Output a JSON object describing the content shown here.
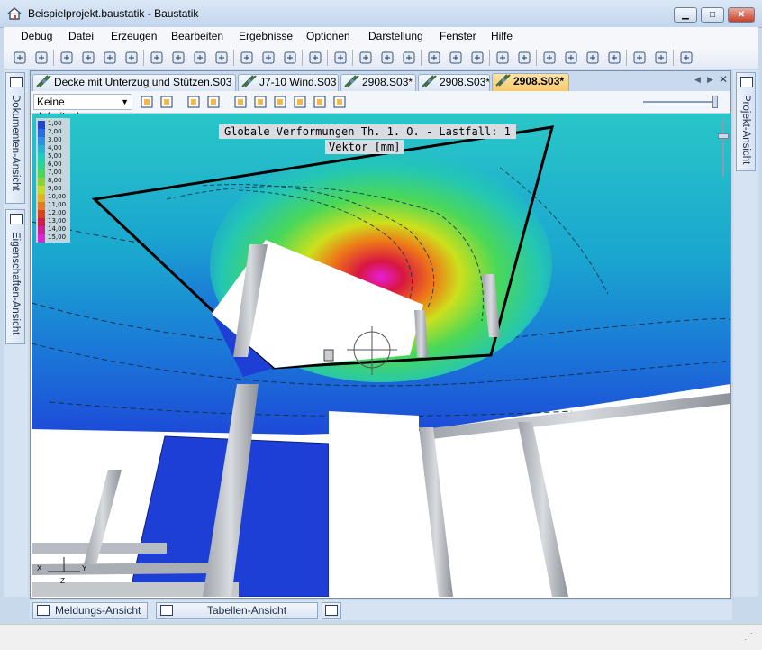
{
  "window": {
    "title": "Beispielprojekt.baustatik - Baustatik",
    "app_icon": "house-icon"
  },
  "menu": [
    "Debug",
    "Datei",
    "Erzeugen",
    "Bearbeiten",
    "Ergebnisse",
    "Optionen",
    "Darstellung",
    "Fenster",
    "Hilfe"
  ],
  "toolbar_icons": [
    "new-document-icon",
    "copy-icon",
    "save-icon",
    "page-icon",
    "preview-icon",
    "print-preview-icon",
    "print-icon",
    "screenshot-icon",
    "lasso-icon",
    "delete-icon",
    "copy-object-icon",
    "undo-icon",
    "redo-icon",
    "layers-icon",
    "cube-view-icon",
    "dimension-icon",
    "point-icon",
    "section-icon",
    "measure-icon",
    "load-icon",
    "beam-load-icon",
    "support-icon",
    "line-load-icon",
    "display-icon",
    "t-section-icon",
    "component-icon",
    "node-icon",
    "calc-icon",
    "table-icon",
    "options-icon"
  ],
  "left_panel": {
    "tab1": "Dokumenten-Ansicht",
    "tab2": "Eigenschaften-Ansicht"
  },
  "right_panel": {
    "tab1": "Projekt-Ansicht"
  },
  "doc_tabs": [
    {
      "label": "Decke mit Unterzug und Stützen.S03",
      "active": false
    },
    {
      "label": "J7-10 Wind.S03",
      "active": false
    },
    {
      "label": "2908.S03*",
      "active": false
    },
    {
      "label": "2908.S03*",
      "active": false
    },
    {
      "label": "2908.S03*",
      "active": true
    }
  ],
  "view_toolbar": {
    "layer": "Keine Arbeitsebenen",
    "icons": [
      "pointer-icon",
      "rotate-view-icon",
      "camera-icon",
      "refresh-icon",
      "wall-front-icon",
      "wall-back-icon",
      "frame-icon",
      "house-front-icon",
      "house-side-icon",
      "house-top-icon"
    ]
  },
  "view": {
    "title_line1": "Globale Verformungen Th. 1. O. - Lastfall: 1",
    "title_line2": "Vektor [mm]",
    "axes": {
      "x": "X",
      "y": "Y",
      "z": "Z"
    }
  },
  "legend": {
    "values": [
      "1,00",
      "2,00",
      "3,00",
      "4,00",
      "5,00",
      "6,00",
      "7,00",
      "8,00",
      "9,00",
      "10,00",
      "11,00",
      "12,00",
      "13,00",
      "14,00",
      "15,00"
    ],
    "colors": [
      "#1f3fd6",
      "#2a66e0",
      "#2b8fe2",
      "#24b3d4",
      "#1fcfb8",
      "#27d88f",
      "#4ad858",
      "#8ed62e",
      "#cde01c",
      "#f1b41c",
      "#ee7a18",
      "#e23b16",
      "#d81640",
      "#d81896",
      "#e51ed8"
    ]
  },
  "bottom_tabs": [
    "Meldungs-Ansicht",
    "Tabellen-Ansicht"
  ],
  "colors": {
    "accent": "#f7c768",
    "frame": "#c9d9ec"
  }
}
